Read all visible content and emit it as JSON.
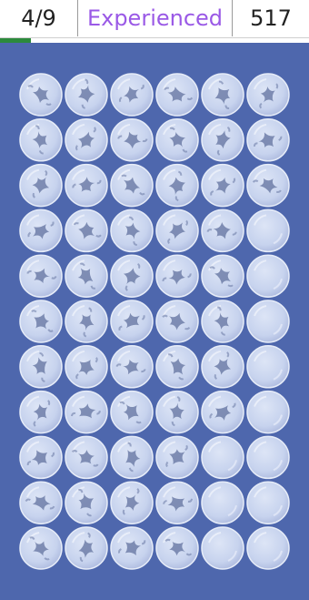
{
  "header": {
    "level_text": "4/9",
    "mode_text": "Experienced",
    "score_text": "517"
  },
  "progress": {
    "fraction": 0.1
  },
  "colors": {
    "board_bg": "#4e67ad",
    "mode_text": "#9a59e6",
    "progress": "#2c8a3c",
    "bubble": "#c7d3ee",
    "bubble_edge": "#e6ecf8",
    "mark": "#6f7ea8"
  },
  "board": {
    "rows": 11,
    "cols": 6,
    "cells": [
      [
        "bubble-marked",
        "bubble-marked",
        "bubble-marked",
        "bubble-marked",
        "bubble-marked",
        "bubble-marked"
      ],
      [
        "bubble-marked",
        "bubble-marked",
        "bubble-marked",
        "bubble-marked",
        "bubble-marked",
        "bubble-marked"
      ],
      [
        "bubble-marked",
        "bubble-marked",
        "bubble-marked",
        "bubble-marked",
        "bubble-marked",
        "bubble-marked"
      ],
      [
        "bubble-marked",
        "bubble-marked",
        "bubble-marked",
        "bubble-marked",
        "bubble-marked",
        "bubble-empty"
      ],
      [
        "bubble-marked",
        "bubble-marked",
        "bubble-marked",
        "bubble-marked",
        "bubble-marked",
        "bubble-empty"
      ],
      [
        "bubble-marked",
        "bubble-marked",
        "bubble-marked",
        "bubble-marked",
        "bubble-marked",
        "bubble-empty"
      ],
      [
        "bubble-marked",
        "bubble-marked",
        "bubble-marked",
        "bubble-marked",
        "bubble-marked",
        "bubble-empty"
      ],
      [
        "bubble-marked",
        "bubble-marked",
        "bubble-marked",
        "bubble-marked",
        "bubble-marked",
        "bubble-empty"
      ],
      [
        "bubble-marked",
        "bubble-marked",
        "bubble-marked",
        "bubble-marked",
        "bubble-empty",
        "bubble-empty"
      ],
      [
        "bubble-marked",
        "bubble-marked",
        "bubble-marked",
        "bubble-marked",
        "bubble-empty",
        "bubble-empty"
      ],
      [
        "bubble-marked",
        "bubble-marked",
        "bubble-marked",
        "bubble-marked",
        "bubble-empty",
        "bubble-empty"
      ]
    ]
  }
}
